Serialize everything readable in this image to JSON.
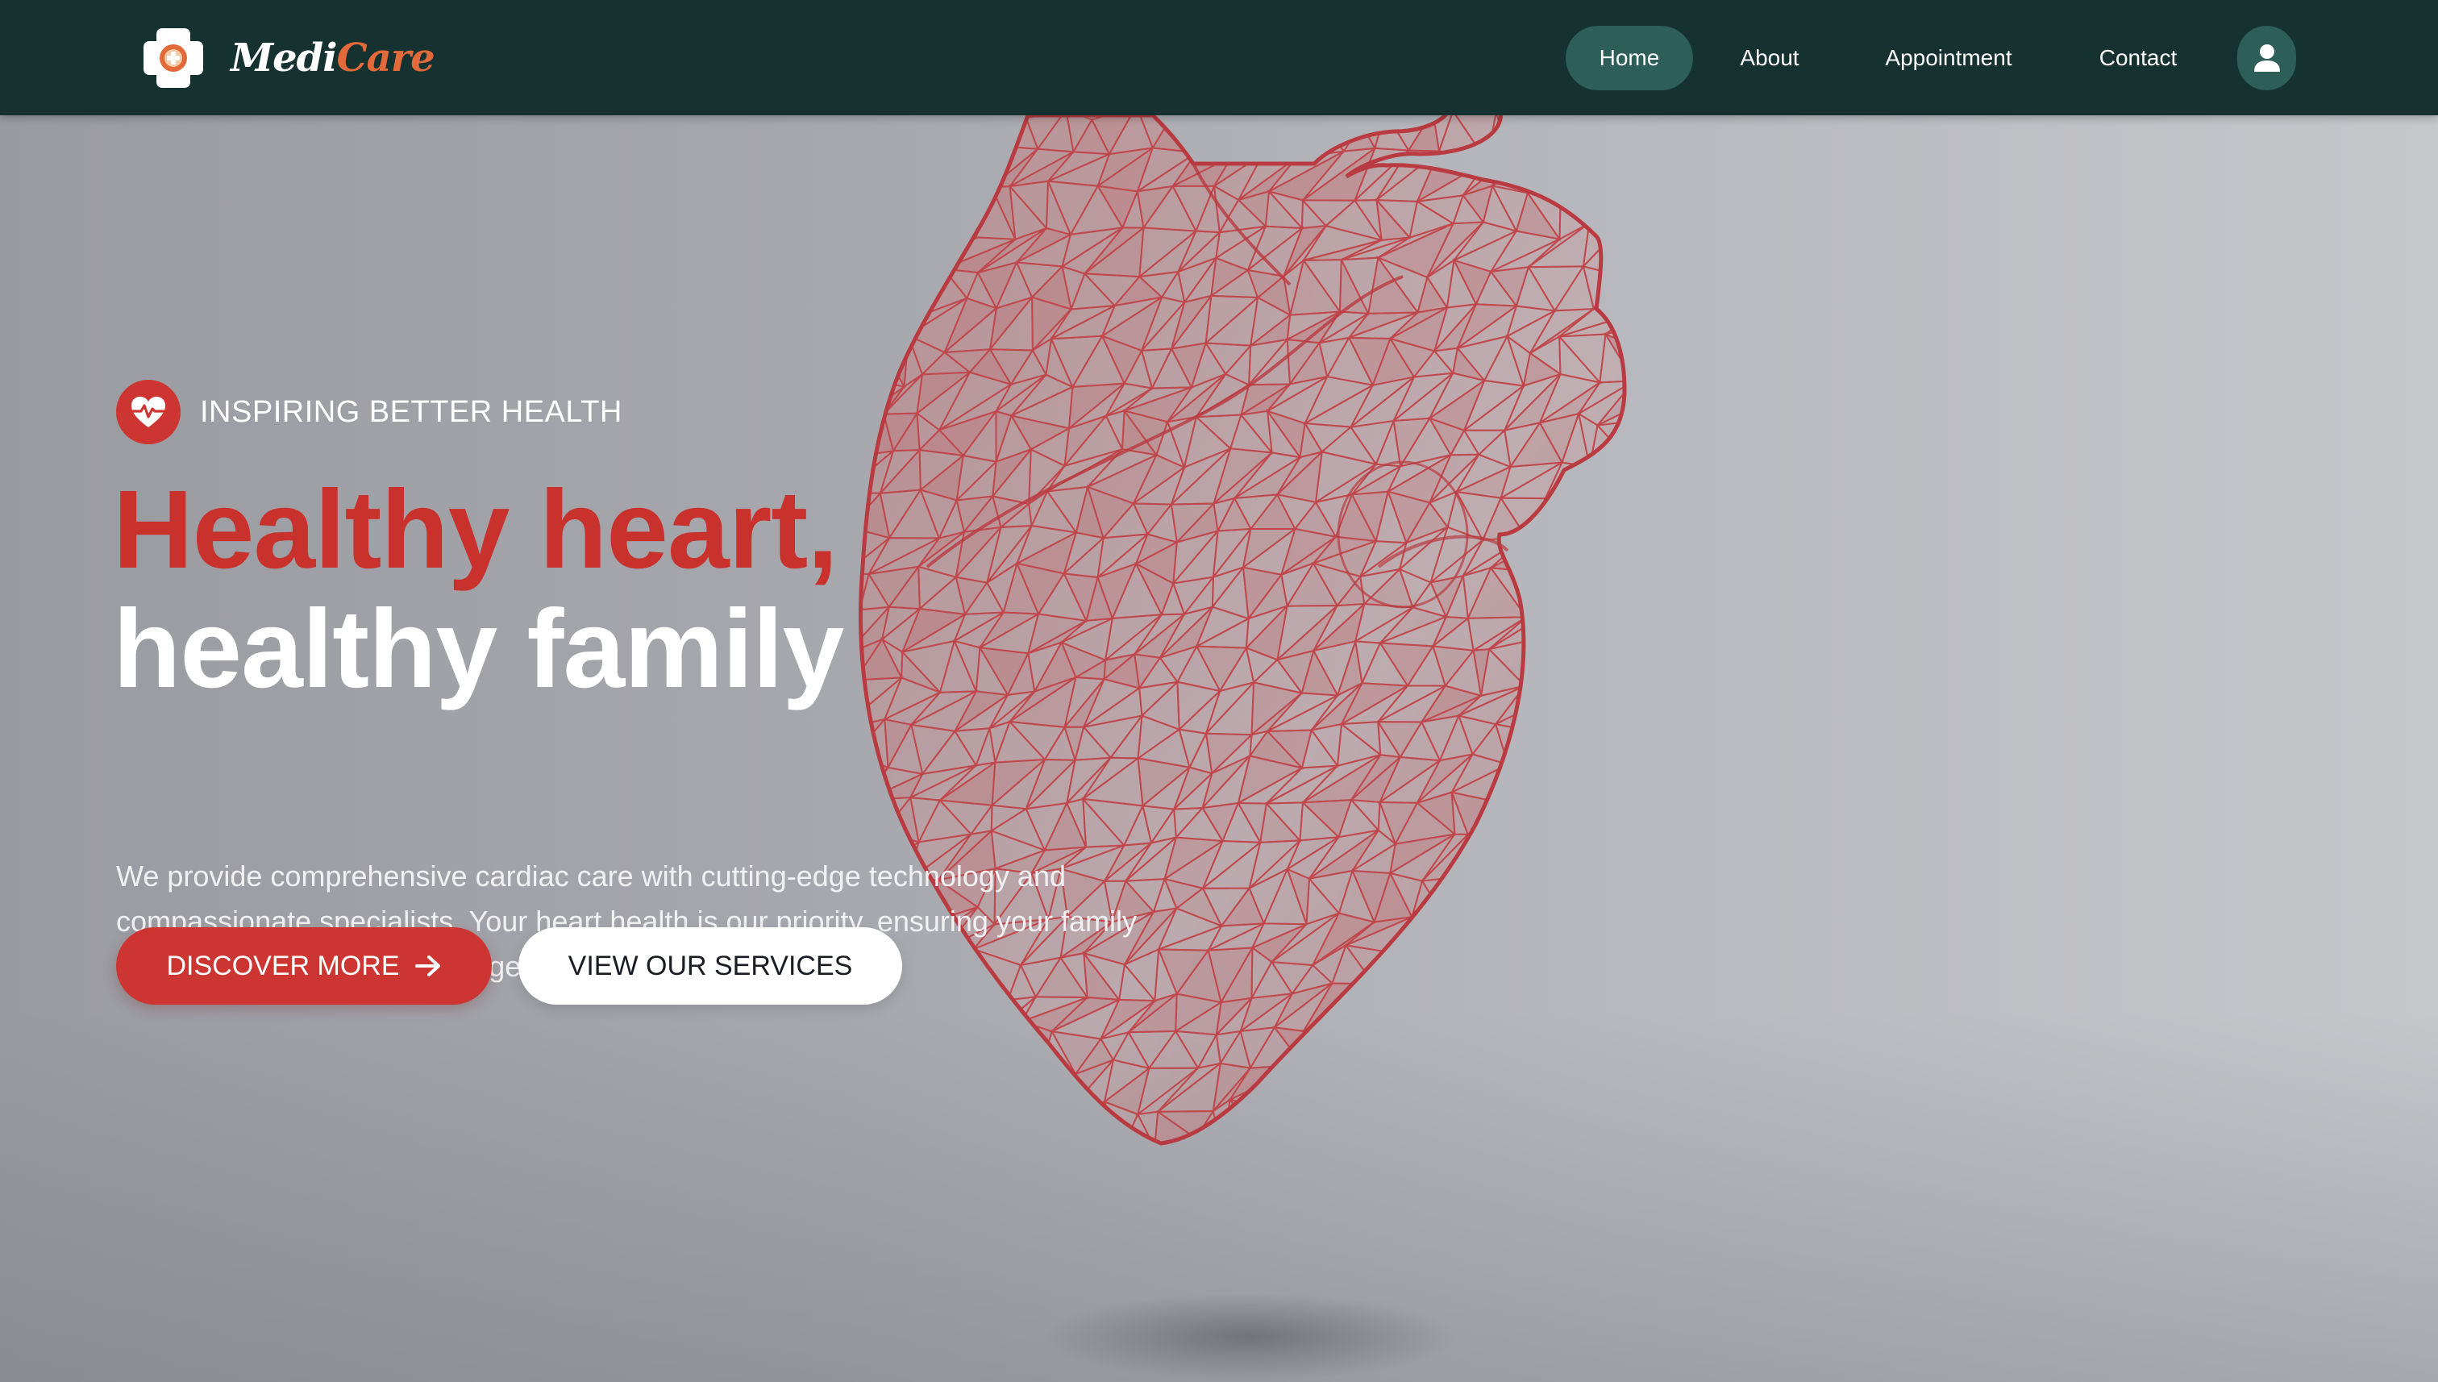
{
  "brand": {
    "name_part1": "Medi",
    "name_part2": "Care",
    "accent_color": "#e2693a",
    "logo_icon": "medical-cross-icon"
  },
  "nav": {
    "items": [
      {
        "label": "Home",
        "active": true
      },
      {
        "label": "About",
        "active": false
      },
      {
        "label": "Appointment",
        "active": false
      },
      {
        "label": "Contact",
        "active": false
      }
    ],
    "profile_icon": "user-icon",
    "background_color": "#163230",
    "active_color": "#2d5e58"
  },
  "hero": {
    "tagline_icon": "heart-pulse-icon",
    "tagline": "INSPIRING BETTER HEALTH",
    "headline_line1": "Healthy heart,",
    "headline_line2": "healthy family",
    "headline_accent_color": "#c9312c",
    "description": "We provide comprehensive cardiac care with cutting-edge technology and compassionate specialists. Your heart health is our priority, ensuring your family enjoys a vibrant, active life together.",
    "primary_button": "DISCOVER MORE",
    "primary_button_icon": "arrow-right-icon",
    "secondary_button": "VIEW OUR SERVICES",
    "image": "wireframe-heart-illustration"
  }
}
